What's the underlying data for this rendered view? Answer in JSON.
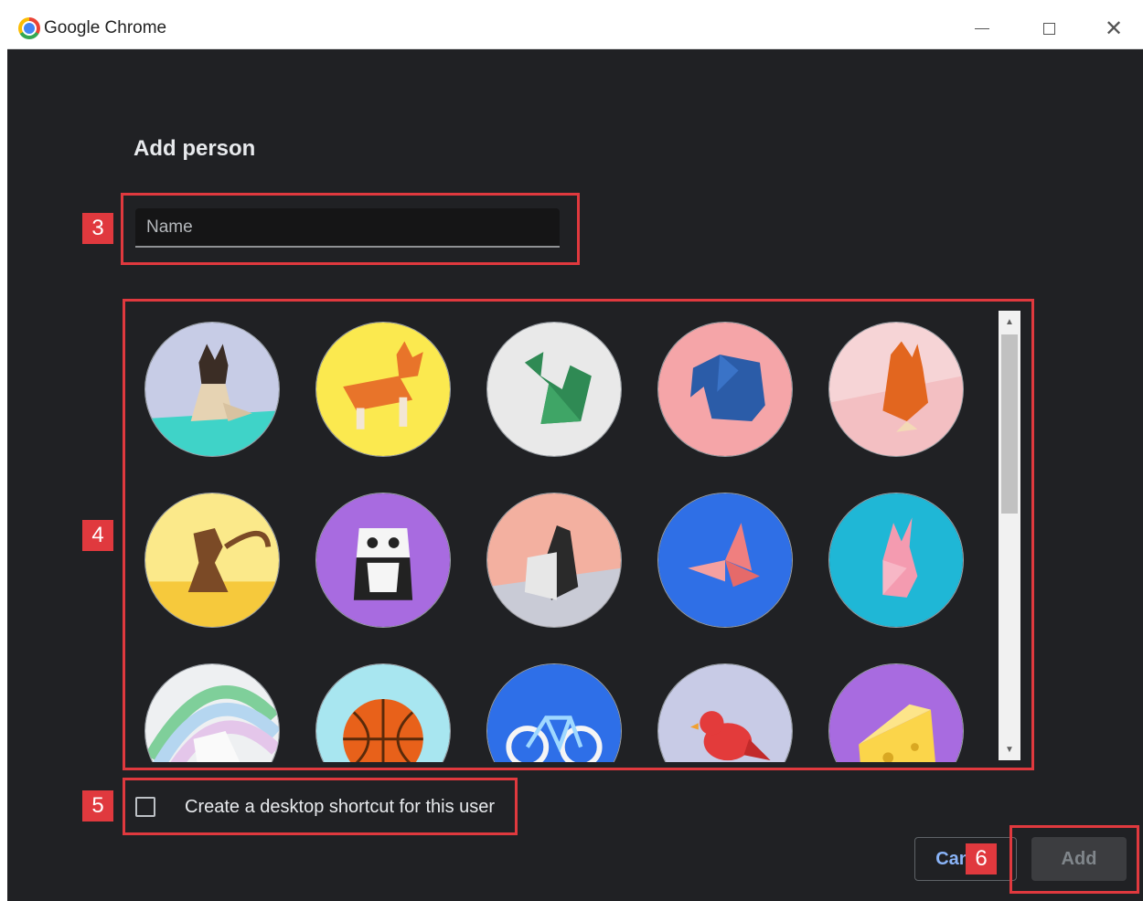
{
  "window": {
    "title": "Google Chrome",
    "controls": {
      "minimize_icon": "minimize-icon",
      "maximize_icon": "maximize-icon",
      "close_icon": "close-icon"
    }
  },
  "dialog": {
    "heading": "Add person",
    "name_input": {
      "value": "",
      "placeholder": "Name"
    },
    "avatars": [
      "origami-cat",
      "origami-corgi",
      "origami-dragon",
      "origami-elephant",
      "origami-fox",
      "origami-monkey",
      "origami-panda",
      "origami-penguin",
      "origami-butterfly",
      "origami-rabbit",
      "origami-unicorn",
      "basketball",
      "bicycle",
      "red-bird",
      "cheese"
    ],
    "shortcut_checkbox": {
      "label": "Create a desktop shortcut for this user",
      "checked": false
    },
    "buttons": {
      "cancel": "Cancel",
      "add": "Add"
    }
  },
  "annotations": [
    "3",
    "4",
    "5",
    "6"
  ],
  "colors": {
    "background": "#202124",
    "annotation": "#e0393e",
    "link": "#8ab4f8"
  }
}
